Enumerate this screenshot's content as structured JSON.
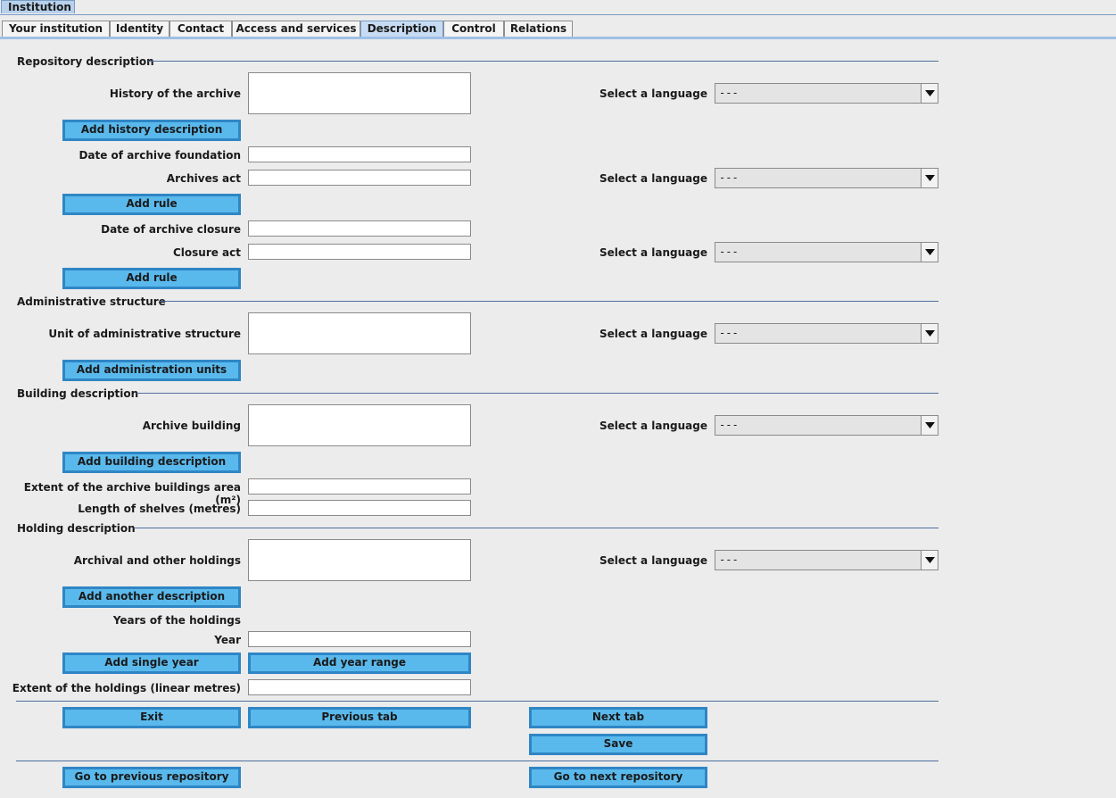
{
  "outer_tab": "Institution",
  "tabs": [
    "Your institution",
    "Identity",
    "Contact",
    "Access and services",
    "Description",
    "Control",
    "Relations"
  ],
  "sections": {
    "repository": "Repository description",
    "administrative": "Administrative structure",
    "building": "Building description",
    "holding": "Holding description"
  },
  "labels": {
    "history": "History of the archive",
    "date_foundation": "Date of archive foundation",
    "archives_act": "Archives act",
    "date_closure": "Date of archive closure",
    "closure_act": "Closure act",
    "unit_admin": "Unit of administrative structure",
    "archive_building": "Archive building",
    "extent_buildings": "Extent of the archive buildings area (m²)",
    "length_shelves": "Length of shelves (metres)",
    "archival_holdings": "Archival and other holdings",
    "years_holdings": "Years of the holdings",
    "year": "Year",
    "extent_holdings": "Extent of the holdings (linear metres)",
    "select_language": "Select a language"
  },
  "language_value": "---",
  "buttons": {
    "add_history": "Add history description",
    "add_rule": "Add rule",
    "add_admin_units": "Add administration units",
    "add_building": "Add building description",
    "add_another": "Add another description",
    "add_single_year": "Add single year",
    "add_year_range": "Add year range",
    "exit": "Exit",
    "previous_tab": "Previous tab",
    "next_tab": "Next tab",
    "save": "Save",
    "prev_repo": "Go to previous repository",
    "next_repo": "Go to next repository"
  },
  "icons": {
    "dropdown": "chevron-down-icon"
  }
}
